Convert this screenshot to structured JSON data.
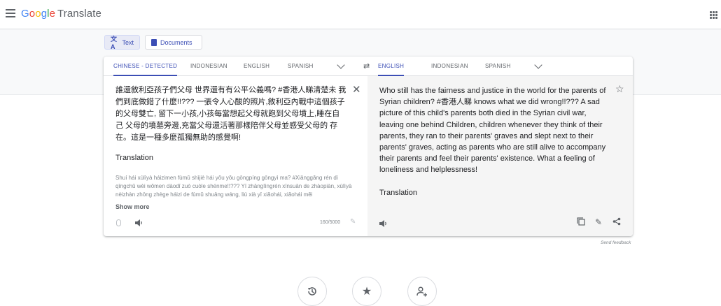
{
  "header": {
    "logo_letters": [
      {
        "char": "G",
        "color": "#4285F4"
      },
      {
        "char": "o",
        "color": "#EA4335"
      },
      {
        "char": "o",
        "color": "#FBBC05"
      },
      {
        "char": "g",
        "color": "#4285F4"
      },
      {
        "char": "l",
        "color": "#34A853"
      },
      {
        "char": "e",
        "color": "#EA4335"
      }
    ],
    "product": "Translate",
    "menu_icon": "hamburger-menu-icon",
    "apps_icon": "apps-grid-icon"
  },
  "modes": {
    "text_label": "Text",
    "documents_label": "Documents"
  },
  "source": {
    "tabs": [
      "CHINESE - DETECTED",
      "INDONESIAN",
      "ENGLISH",
      "SPANISH"
    ],
    "active_tab": 0,
    "text": "誰還敘利亞孩子們父母 世界還有有公平公義嗎? #香港人睇清楚未 我們到底做錯了什麼!!??? 一張令人心酸的照片,敘利亞內戰中這個孩子的父母雙亡, 留下一小孩,小孩每當想起父母就跑到父母墳上,睡在自己 父母的墳墓旁邊,充當父母還活著那樣陪伴父母並感受父母的 存在。這是一種多麼孤獨無助的感覺啊!",
    "translation_label": "Translation",
    "romanization": "Shuí hái xùlìyà háizimen fùmǔ shìjiè hái yǒu yǒu gōngpíng gōngyì ma? #Xiānggǎng rén dì qīngchǔ wèi wǒmen dàodǐ zuò cuòle shénme!!??? Yī zhāngIìngrén xīnsuān de zhàopiàn, xùlìyà nèizhàn zhōng zhège háizi de fùmǔ shuāng wáng, liú xià yī xiǎohái, xiǎohái měi",
    "show_more": "Show more",
    "char_count": "160/5000"
  },
  "target": {
    "tabs": [
      "ENGLISH",
      "INDONESIAN",
      "SPANISH"
    ],
    "active_tab": 0,
    "text": "Who still has the fairness and justice in the world for the parents of Syrian children? #香港人睇 knows what we did wrong!!??? A sad picture of this child's parents both died in the Syrian civil war, leaving one behind Children, children whenever they think of their parents, they ran to their parents' graves and slept next to their parents' graves, acting as parents who are still alive to accompany their parents and feel their parents' existence. What a feeling of loneliness and helplessness!",
    "translation_label": "Translation"
  },
  "footer": {
    "send_feedback": "Send feedback"
  },
  "colors": {
    "accent": "#3c4eb5",
    "band": "#f8f9fa",
    "target_bg": "#f5f5f5"
  }
}
